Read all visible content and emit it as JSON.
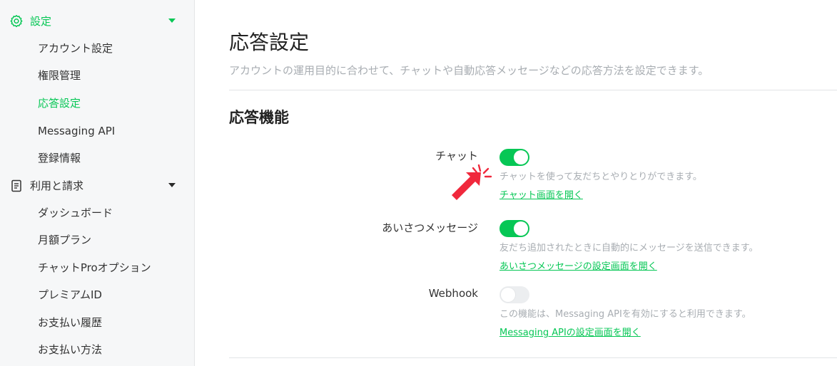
{
  "sidebar": {
    "groups": [
      {
        "label": "設定",
        "icon": "gear-icon",
        "active": true,
        "items": [
          {
            "label": "アカウント設定"
          },
          {
            "label": "権限管理"
          },
          {
            "label": "応答設定",
            "active": true
          },
          {
            "label": "Messaging API"
          },
          {
            "label": "登録情報"
          }
        ]
      },
      {
        "label": "利用と請求",
        "icon": "receipt-icon",
        "items": [
          {
            "label": "ダッシュボード"
          },
          {
            "label": "月額プラン"
          },
          {
            "label": "チャットProオプション"
          },
          {
            "label": "プレミアムID"
          },
          {
            "label": "お支払い履歴"
          },
          {
            "label": "お支払い方法"
          }
        ]
      }
    ]
  },
  "main": {
    "title": "応答設定",
    "description": "アカウントの運用目的に合わせて、チャットや自動応答メッセージなどの応答方法を設定できます。",
    "section_title": "応答機能",
    "rows": [
      {
        "label": "チャット",
        "enabled": true,
        "description": "チャットを使って友だちとやりとりができます。",
        "link": "チャット画面を開く"
      },
      {
        "label": "あいさつメッセージ",
        "enabled": true,
        "description": "友だち追加されたときに自動的にメッセージを送信できます。",
        "link": "あいさつメッセージの設定画面を開く"
      },
      {
        "label": "Webhook",
        "enabled": false,
        "description": "この機能は、Messaging APIを有効にすると利用できます。",
        "link": "Messaging APIの設定画面を開く"
      }
    ]
  },
  "colors": {
    "accent": "#06c755",
    "pointer": "#f0283c"
  }
}
